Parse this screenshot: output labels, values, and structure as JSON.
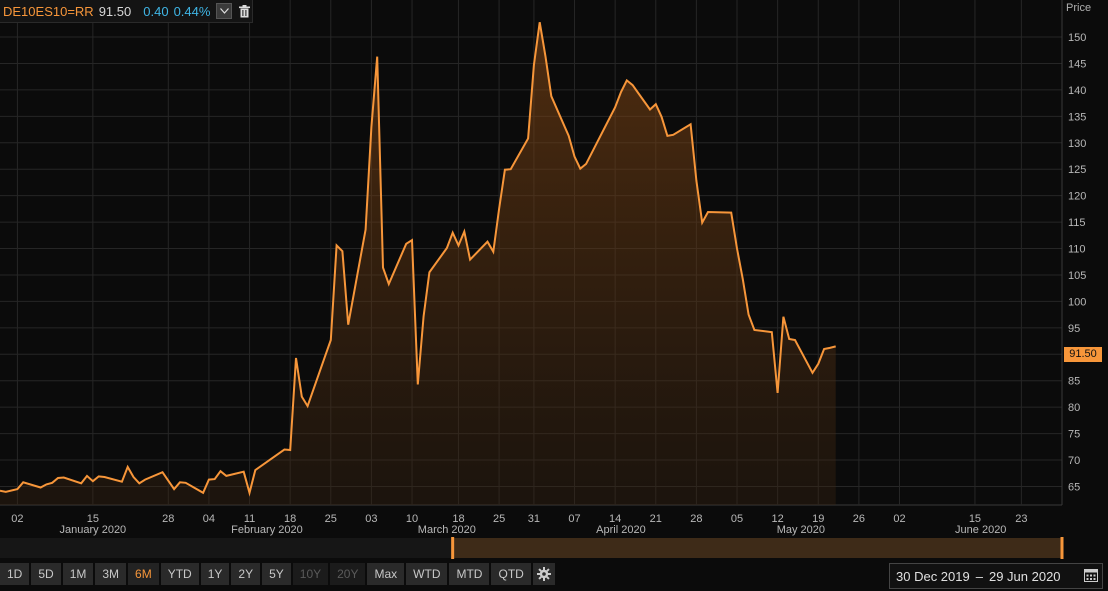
{
  "header": {
    "ric": "DE10ES10=RR",
    "last": "91.50",
    "change": "0.40",
    "change_pct": "0.44%",
    "dropdown_icon": "chevron-down-icon",
    "delete_icon": "trash-icon"
  },
  "colors": {
    "line": "#f7963a",
    "change": "#3fb5e5",
    "background": "#0b0b0b",
    "active_tab": "#f7963a"
  },
  "chart_data": {
    "type": "area",
    "ylabel": "Price",
    "ylim": [
      61.5,
      157
    ],
    "y_ticks": [
      65,
      70,
      75,
      80,
      85,
      90,
      95,
      100,
      105,
      110,
      115,
      120,
      125,
      130,
      135,
      140,
      145,
      150
    ],
    "last_value_label": "91.50",
    "grid": true,
    "x_start": "2019-12-30",
    "x_end": "2020-06-30",
    "x_ticks": [
      {
        "label": "02",
        "date": "2020-01-02"
      },
      {
        "label": "15",
        "date": "2020-01-15"
      },
      {
        "label": "28",
        "date": "2020-01-28"
      },
      {
        "label": "04",
        "date": "2020-02-04"
      },
      {
        "label": "11",
        "date": "2020-02-11"
      },
      {
        "label": "18",
        "date": "2020-02-18"
      },
      {
        "label": "25",
        "date": "2020-02-25"
      },
      {
        "label": "03",
        "date": "2020-03-03"
      },
      {
        "label": "10",
        "date": "2020-03-10"
      },
      {
        "label": "18",
        "date": "2020-03-18"
      },
      {
        "label": "25",
        "date": "2020-03-25"
      },
      {
        "label": "31",
        "date": "2020-03-31"
      },
      {
        "label": "07",
        "date": "2020-04-07"
      },
      {
        "label": "14",
        "date": "2020-04-14"
      },
      {
        "label": "21",
        "date": "2020-04-21"
      },
      {
        "label": "28",
        "date": "2020-04-28"
      },
      {
        "label": "05",
        "date": "2020-05-05"
      },
      {
        "label": "12",
        "date": "2020-05-12"
      },
      {
        "label": "19",
        "date": "2020-05-19"
      },
      {
        "label": "26",
        "date": "2020-05-26"
      },
      {
        "label": "02",
        "date": "2020-06-02"
      },
      {
        "label": "15",
        "date": "2020-06-15"
      },
      {
        "label": "23",
        "date": "2020-06-23"
      }
    ],
    "months": [
      {
        "label": "January 2020",
        "date": "2020-01-15"
      },
      {
        "label": "February 2020",
        "date": "2020-02-14"
      },
      {
        "label": "March 2020",
        "date": "2020-03-16"
      },
      {
        "label": "April 2020",
        "date": "2020-04-15"
      },
      {
        "label": "May 2020",
        "date": "2020-05-16"
      },
      {
        "label": "June 2020",
        "date": "2020-06-16"
      }
    ],
    "series": [
      {
        "values": [
          [
            "2019-12-30",
            64.2
          ],
          [
            "2019-12-31",
            64.0
          ],
          [
            "2020-01-02",
            64.5
          ],
          [
            "2020-01-03",
            65.8
          ],
          [
            "2020-01-06",
            64.8
          ],
          [
            "2020-01-07",
            65.4
          ],
          [
            "2020-01-08",
            65.7
          ],
          [
            "2020-01-09",
            66.6
          ],
          [
            "2020-01-10",
            66.7
          ],
          [
            "2020-01-13",
            65.6
          ],
          [
            "2020-01-14",
            67.0
          ],
          [
            "2020-01-15",
            66.0
          ],
          [
            "2020-01-16",
            66.9
          ],
          [
            "2020-01-17",
            66.8
          ],
          [
            "2020-01-20",
            65.9
          ],
          [
            "2020-01-21",
            68.7
          ],
          [
            "2020-01-22",
            66.8
          ],
          [
            "2020-01-23",
            65.6
          ],
          [
            "2020-01-24",
            66.3
          ],
          [
            "2020-01-27",
            67.7
          ],
          [
            "2020-01-28",
            66.1
          ],
          [
            "2020-01-29",
            64.5
          ],
          [
            "2020-01-30",
            65.8
          ],
          [
            "2020-01-31",
            65.7
          ],
          [
            "2020-02-03",
            63.8
          ],
          [
            "2020-02-04",
            66.3
          ],
          [
            "2020-02-05",
            66.4
          ],
          [
            "2020-02-06",
            67.9
          ],
          [
            "2020-02-07",
            67.0
          ],
          [
            "2020-02-10",
            67.8
          ],
          [
            "2020-02-11",
            63.8
          ],
          [
            "2020-02-12",
            68.1
          ],
          [
            "2020-02-17",
            72.0
          ],
          [
            "2020-02-18",
            71.9
          ],
          [
            "2020-02-19",
            89.3
          ],
          [
            "2020-02-20",
            82.0
          ],
          [
            "2020-02-21",
            80.2
          ],
          [
            "2020-02-24",
            89.6
          ],
          [
            "2020-02-25",
            92.7
          ],
          [
            "2020-02-26",
            110.6
          ],
          [
            "2020-02-27",
            109.5
          ],
          [
            "2020-02-28",
            95.6
          ],
          [
            "2020-03-02",
            113.6
          ],
          [
            "2020-03-03",
            133.0
          ],
          [
            "2020-03-04",
            146.3
          ],
          [
            "2020-03-05",
            106.4
          ],
          [
            "2020-03-06",
            103.3
          ],
          [
            "2020-03-09",
            110.9
          ],
          [
            "2020-03-10",
            111.6
          ],
          [
            "2020-03-11",
            84.3
          ],
          [
            "2020-03-12",
            97.2
          ],
          [
            "2020-03-13",
            105.5
          ],
          [
            "2020-03-16",
            110.1
          ],
          [
            "2020-03-17",
            113.0
          ],
          [
            "2020-03-18",
            110.6
          ],
          [
            "2020-03-19",
            113.2
          ],
          [
            "2020-03-20",
            107.9
          ],
          [
            "2020-03-23",
            111.3
          ],
          [
            "2020-03-24",
            109.4
          ],
          [
            "2020-03-25",
            117.5
          ],
          [
            "2020-03-26",
            124.9
          ],
          [
            "2020-03-27",
            125.0
          ],
          [
            "2020-03-30",
            130.8
          ],
          [
            "2020-03-31",
            144.7
          ],
          [
            "2020-04-01",
            152.8
          ],
          [
            "2020-04-02",
            146.3
          ],
          [
            "2020-04-03",
            138.8
          ],
          [
            "2020-04-06",
            131.3
          ],
          [
            "2020-04-07",
            127.4
          ],
          [
            "2020-04-08",
            125.1
          ],
          [
            "2020-04-09",
            126.0
          ],
          [
            "2020-04-14",
            136.7
          ],
          [
            "2020-04-15",
            139.6
          ],
          [
            "2020-04-16",
            141.8
          ],
          [
            "2020-04-17",
            140.9
          ],
          [
            "2020-04-20",
            136.3
          ],
          [
            "2020-04-21",
            137.3
          ],
          [
            "2020-04-22",
            134.9
          ],
          [
            "2020-04-23",
            131.3
          ],
          [
            "2020-04-24",
            131.5
          ],
          [
            "2020-04-27",
            133.5
          ],
          [
            "2020-04-28",
            122.8
          ],
          [
            "2020-04-29",
            114.9
          ],
          [
            "2020-04-30",
            116.9
          ],
          [
            "2020-05-04",
            116.8
          ],
          [
            "2020-05-05",
            110.0
          ],
          [
            "2020-05-06",
            104.2
          ],
          [
            "2020-05-07",
            97.5
          ],
          [
            "2020-05-08",
            94.6
          ],
          [
            "2020-05-11",
            94.2
          ],
          [
            "2020-05-12",
            82.7
          ],
          [
            "2020-05-13",
            97.1
          ],
          [
            "2020-05-14",
            92.9
          ],
          [
            "2020-05-15",
            92.7
          ],
          [
            "2020-05-18",
            86.5
          ],
          [
            "2020-05-19",
            88.2
          ],
          [
            "2020-05-20",
            91.0
          ],
          [
            "2020-05-21",
            91.2
          ],
          [
            "2020-05-22",
            91.5
          ]
        ]
      }
    ]
  },
  "navigator": {
    "range_start": "2019-12-30",
    "range_end": "2020-06-30",
    "window_start": "2020-03-17",
    "window_end": "2020-06-30"
  },
  "toolbar": {
    "buttons": [
      {
        "label": "1D",
        "state": "normal"
      },
      {
        "label": "5D",
        "state": "normal"
      },
      {
        "label": "1M",
        "state": "normal"
      },
      {
        "label": "3M",
        "state": "normal"
      },
      {
        "label": "6M",
        "state": "active"
      },
      {
        "label": "YTD",
        "state": "normal"
      },
      {
        "label": "1Y",
        "state": "normal"
      },
      {
        "label": "2Y",
        "state": "normal"
      },
      {
        "label": "5Y",
        "state": "normal"
      },
      {
        "label": "10Y",
        "state": "disabled"
      },
      {
        "label": "20Y",
        "state": "disabled"
      },
      {
        "label": "Max",
        "state": "normal"
      },
      {
        "label": "WTD",
        "state": "normal"
      },
      {
        "label": "MTD",
        "state": "normal"
      },
      {
        "label": "QTD",
        "state": "normal"
      }
    ],
    "settings_icon": "gear-icon"
  },
  "date_range": {
    "from": "30 Dec 2019",
    "separator": "–",
    "to": "29 Jun 2020",
    "calendar_icon": "calendar-icon"
  }
}
